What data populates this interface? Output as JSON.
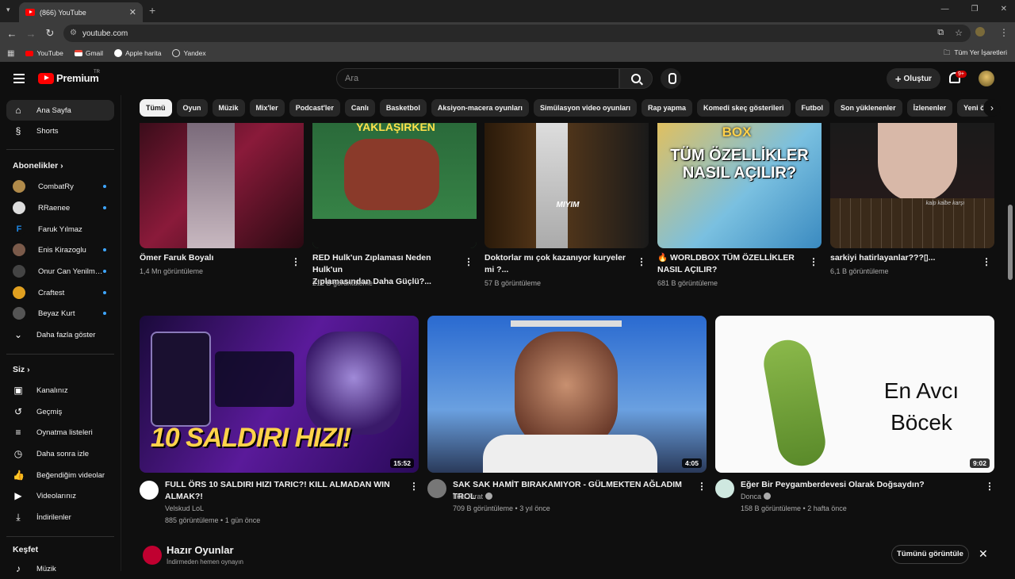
{
  "browser": {
    "tab_title": "(866) YouTube",
    "url": "youtube.com",
    "bookmarks": [
      {
        "label": "YouTube",
        "color": "#ff0000"
      },
      {
        "label": "Gmail",
        "color": "#ea4335"
      },
      {
        "label": "Apple harita",
        "color": "#ffffff"
      },
      {
        "label": "Yandex",
        "color": "#dddddd"
      }
    ],
    "all_bookmarks": "Tüm Yer İşaretleri"
  },
  "header": {
    "logo_text": "Premium",
    "logo_tr": "TR",
    "search_placeholder": "Ara",
    "create_label": "Oluştur",
    "notif_badge": "9+"
  },
  "sidebar": {
    "home": "Ana Sayfa",
    "shorts": "Shorts",
    "subs_header": "Abonelikler",
    "subs": [
      {
        "name": "CombatRy",
        "color": "#b08a4a"
      },
      {
        "name": "RRaenee",
        "color": "#dddddd"
      },
      {
        "name": "Faruk Yılmaz",
        "color": "#1e88e5"
      },
      {
        "name": "Enis Kirazoglu",
        "color": "#7a5a4a"
      },
      {
        "name": "Onur Can Yenilm…",
        "color": "#444444"
      },
      {
        "name": "Craftest",
        "color": "#e0a020"
      },
      {
        "name": "Beyaz Kurt",
        "color": "#555555"
      }
    ],
    "show_more": "Daha fazla göster",
    "you_header": "Siz",
    "you_items": [
      "Kanalınız",
      "Geçmiş",
      "Oynatma listeleri",
      "Daha sonra izle",
      "Beğendiğim videolar",
      "Videolarınız",
      "İndirilenler"
    ],
    "explore_header": "Keşfet",
    "explore_first": "Müzik"
  },
  "chips": [
    "Tümü",
    "Oyun",
    "Müzik",
    "Mix'ler",
    "Podcast'ler",
    "Canlı",
    "Basketbol",
    "Aksiyon-macera oyunları",
    "Simülasyon video oyunları",
    "Rap yapma",
    "Komedi skeç gösterileri",
    "Futbol",
    "Son yüklenenler",
    "İzlenenler",
    "Yeni ö"
  ],
  "row1": [
    {
      "title1": "Ömer Faruk Boyalı",
      "title2": "",
      "meta": "1,4 Mn görüntüleme",
      "overlay": ""
    },
    {
      "title1": "RED Hulk'un Zıplaması Neden Hulk'un",
      "title2": "Zıplamasından Daha Güçlü?...",
      "meta": "212 B görüntüleme",
      "overlay": "YAKLAŞIRKEN"
    },
    {
      "title1": "Doktorlar mı çok kazanıyor kuryeler",
      "title2": "mi ?...",
      "meta": "57 B görüntüleme",
      "overlay": "MIYIM"
    },
    {
      "title1": "🔥 WORLDBOX TÜM ÖZELLİKLER",
      "title2": "NASIL AÇILIR?",
      "meta": "681 B görüntüleme",
      "overlay": "TÜM ÖZELLİKLER NASIL AÇILIR?",
      "overlay_top": "BOX"
    },
    {
      "title1": "sarkiyi hatirlayanlar???▯...",
      "title2": "",
      "meta": "6,1 B görüntüleme",
      "overlay": "kalp kalbe karşı"
    }
  ],
  "row2": [
    {
      "title1": "FULL ÖRS 10 SALDIRI HIZI TARIC?! KILL ALMADAN WIN",
      "title2": "ALMAK?!",
      "channel": "Velskud LoL",
      "meta": "885 görüntüleme • 1 gün önce",
      "duration": "15:52",
      "overlay": "10 SALDIRI HIZI!",
      "verified": false
    },
    {
      "title1": "SAK SAK HAMİT BIRAKAMIYOR - GÜLMEKTEN AĞLADIM TROL",
      "title2": "",
      "channel": "İlker Fırat",
      "meta": "709 B görüntüleme • 3 yıl önce",
      "duration": "4:05",
      "overlay": "",
      "verified": true
    },
    {
      "title1": "Eğer Bir Peygamberdevesi Olarak Doğsaydın?",
      "title2": "",
      "channel": "Donca",
      "meta": "158 B görüntüleme • 2 hafta önce",
      "duration": "9:02",
      "overlay": "En Avcı Böcek",
      "verified": true
    }
  ],
  "games": {
    "title": "Hazır Oyunlar",
    "subtitle": "İndirmeden hemen oynayın",
    "show_all": "Tümünü görüntüle"
  }
}
